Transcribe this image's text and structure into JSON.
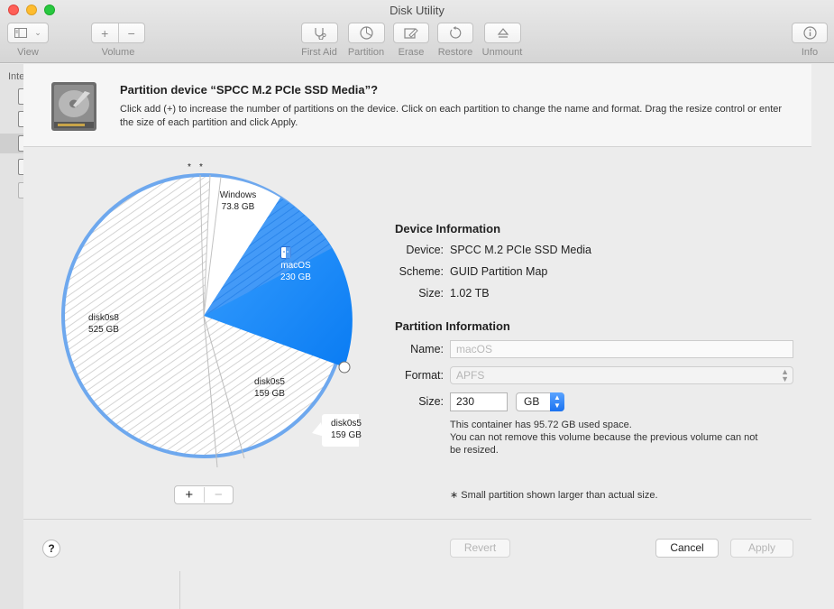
{
  "window": {
    "title": "Disk Utility"
  },
  "toolbar": {
    "view_label": "View",
    "volume_label": "Volume",
    "first_aid_label": "First Aid",
    "partition_label": "Partition",
    "erase_label": "Erase",
    "restore_label": "Restore",
    "unmount_label": "Unmount",
    "info_label": "Info"
  },
  "sidebar": {
    "section_label": "Inte"
  },
  "sheet": {
    "title": "Partition device “SPCC M.2 PCIe SSD Media”?",
    "description": "Click add (+) to increase the number of partitions on the device. Click on each partition to change the name and format. Drag the resize control or enter the size of each partition and click Apply."
  },
  "pie": {
    "partitions": [
      {
        "name": "Windows",
        "size": "73.8 GB"
      },
      {
        "name": "macOS",
        "size": "230 GB"
      },
      {
        "name": "disk0s5",
        "size": "159 GB"
      },
      {
        "name": "disk0s8",
        "size": "525 GB"
      }
    ],
    "small_marker_1": "*",
    "small_marker_2": "*",
    "tooltip": {
      "name": "disk0s5",
      "size": "159 GB"
    },
    "add_label": "+",
    "remove_label": "−",
    "accent_color": "#1a8cff"
  },
  "device_info": {
    "heading": "Device Information",
    "device_label": "Device:",
    "device_value": "SPCC M.2 PCIe SSD Media",
    "scheme_label": "Scheme:",
    "scheme_value": "GUID Partition Map",
    "size_label": "Size:",
    "size_value": "1.02 TB"
  },
  "partition_info": {
    "heading": "Partition Information",
    "name_label": "Name:",
    "name_placeholder": "macOS",
    "format_label": "Format:",
    "format_value": "APFS",
    "size_label": "Size:",
    "size_value": "230",
    "unit_value": "GB",
    "note_line1": "This container has 95.72 GB used space.",
    "note_line2": "You can not remove this volume because the previous volume can not",
    "note_line3": "be resized.",
    "small_note": "∗ Small partition shown larger than actual size."
  },
  "footer": {
    "help_label": "?",
    "revert_label": "Revert",
    "cancel_label": "Cancel",
    "apply_label": "Apply"
  }
}
